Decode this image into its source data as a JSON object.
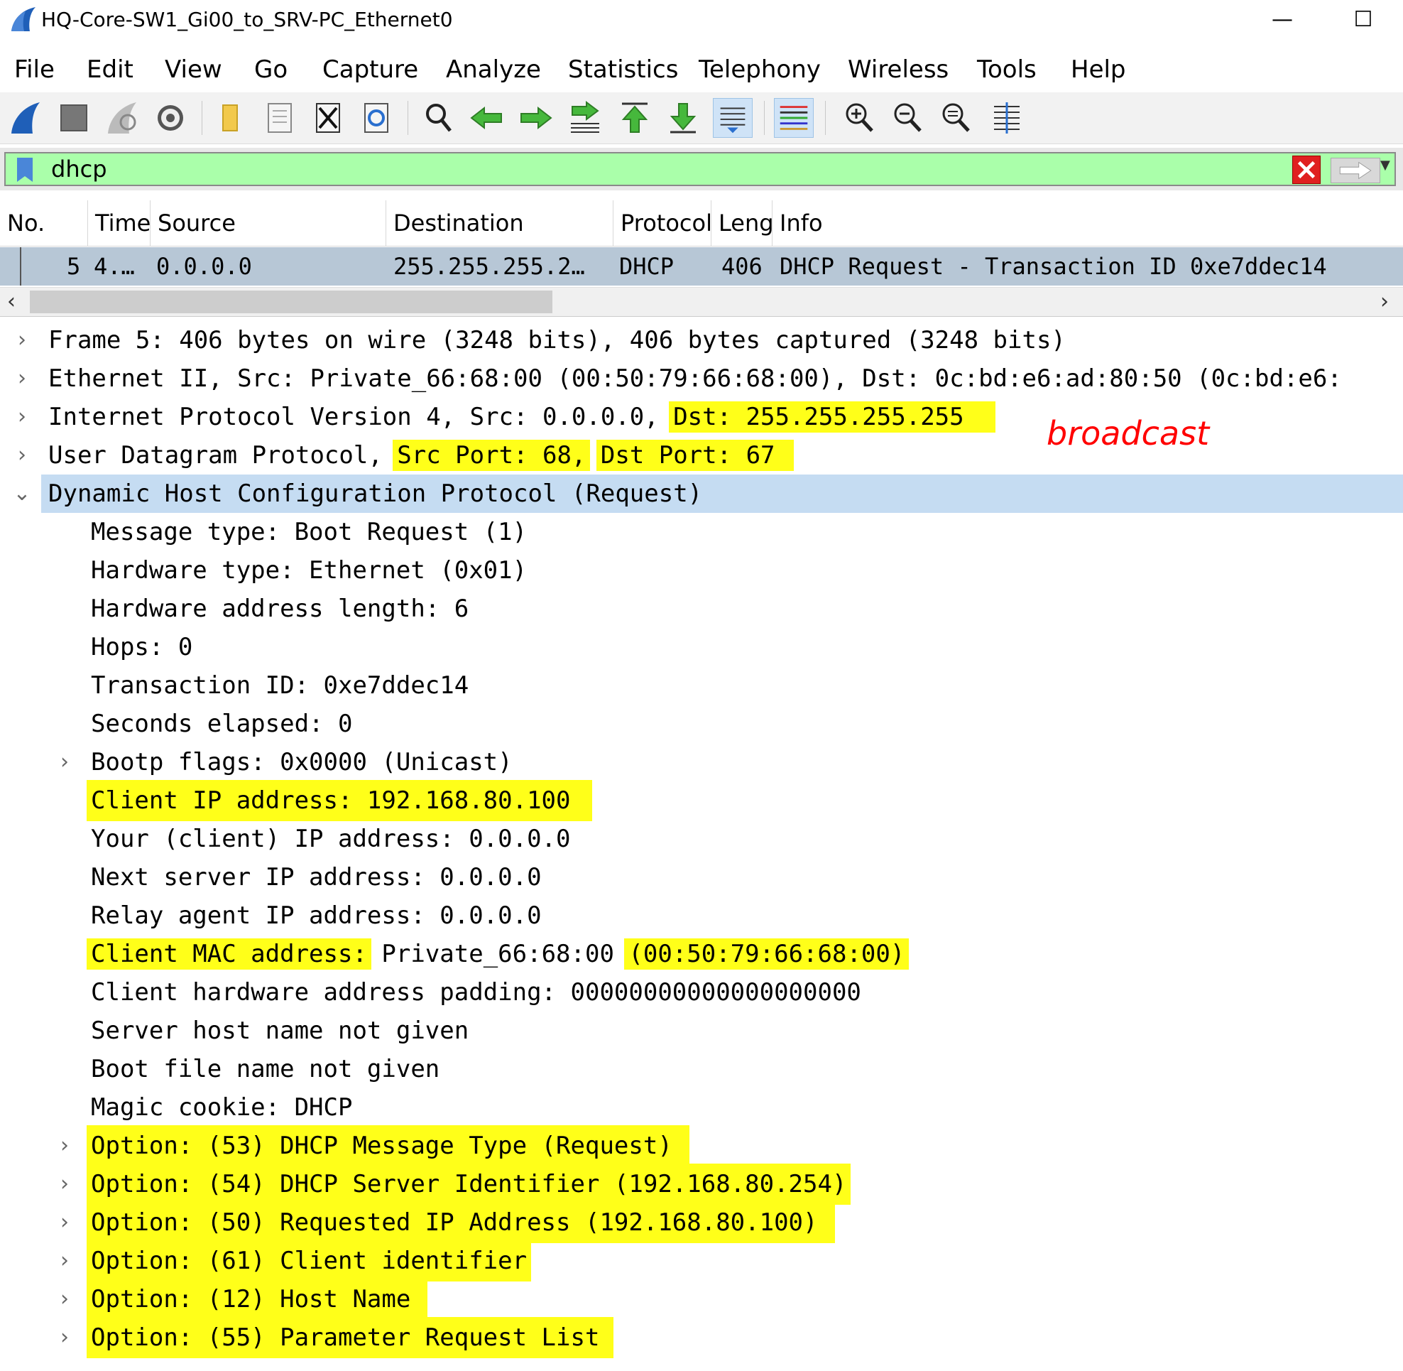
{
  "window": {
    "title": "HQ-Core-SW1_Gi00_to_SRV-PC_Ethernet0",
    "minimize_glyph": "—",
    "maximize_glyph": "☐"
  },
  "menu": [
    "File",
    "Edit",
    "View",
    "Go",
    "Capture",
    "Analyze",
    "Statistics",
    "Telephony",
    "Wireless",
    "Tools",
    "Help"
  ],
  "toolbar": {
    "icons": [
      "shark-fin-start-icon",
      "stop-square-icon",
      "restart-fin-icon",
      "capture-options-gear-icon",
      "open-folder-icon",
      "open-file-icon",
      "close-file-icon",
      "reload-file-icon",
      "find-magnifier-icon",
      "go-back-arrow-icon",
      "go-forward-arrow-icon",
      "go-to-packet-icon",
      "first-packet-icon",
      "last-packet-icon",
      "auto-scroll-icon",
      "colorize-icon",
      "zoom-in-icon",
      "zoom-out-icon",
      "normal-size-icon",
      "resize-columns-icon"
    ]
  },
  "filter": {
    "value": "dhcp",
    "background_color": "#aaffaa"
  },
  "packet_list": {
    "columns": [
      "No.",
      "Time",
      "Source",
      "Destination",
      "Protocol",
      "Length",
      "Info"
    ],
    "rows": [
      {
        "no": "5",
        "time": "4.…",
        "source": "0.0.0.0",
        "destination": "255.255.255.2…",
        "protocol": "DHCP",
        "length": "406",
        "info": "DHCP Request  - Transaction ID 0xe7ddec14"
      }
    ]
  },
  "details": {
    "frame": "Frame 5: 406 bytes on wire (3248 bits), 406 bytes captured (3248 bits)",
    "ethernet": "Ethernet II, Src: Private_66:68:00 (00:50:79:66:68:00), Dst: 0c:bd:e6:ad:80:50 (0c:bd:e6:",
    "ip_prefix": "Internet Protocol Version 4, Src: 0.0.0.0, ",
    "ip_dst": "Dst: 255.255.255.255",
    "udp_prefix": "User Datagram Protocol, ",
    "udp_src": "Src Port: 68,",
    "udp_dst": "Dst Port: 67",
    "dhcp": "Dynamic Host Configuration Protocol (Request)",
    "fields": {
      "message_type": "Message type: Boot Request (1)",
      "hardware_type": "Hardware type: Ethernet (0x01)",
      "hw_addr_len": "Hardware address length: 6",
      "hops": "Hops: 0",
      "transaction_id": "Transaction ID: 0xe7ddec14",
      "seconds": "Seconds elapsed: 0",
      "bootp_flags": "Bootp flags: 0x0000 (Unicast)",
      "client_ip": "Client IP address: 192.168.80.100",
      "your_ip": "Your (client) IP address: 0.0.0.0",
      "next_server": "Next server IP address: 0.0.0.0",
      "relay_agent": "Relay agent IP address: 0.0.0.0",
      "client_mac_label": "Client MAC address:",
      "client_mac_name": " Private_66:68:00 ",
      "client_mac_value": "(00:50:79:66:68:00)",
      "hw_padding": "Client hardware address padding: 00000000000000000000",
      "server_host": "Server host name not given",
      "boot_file": "Boot file name not given",
      "magic_cookie": "Magic cookie: DHCP"
    },
    "options": [
      "Option: (53) DHCP Message Type (Request)",
      "Option: (54) DHCP Server Identifier (192.168.80.254)",
      "Option: (50) Requested IP Address (192.168.80.100)",
      "Option: (61) Client identifier",
      "Option: (12) Host Name",
      "Option: (55) Parameter Request List"
    ]
  },
  "annotation": {
    "text": "broadcast",
    "color": "#ff0000"
  },
  "colors": {
    "highlight": "#ffff19",
    "selected_row": "#b7c7d6",
    "selected_tree": "#c5dcf2"
  }
}
